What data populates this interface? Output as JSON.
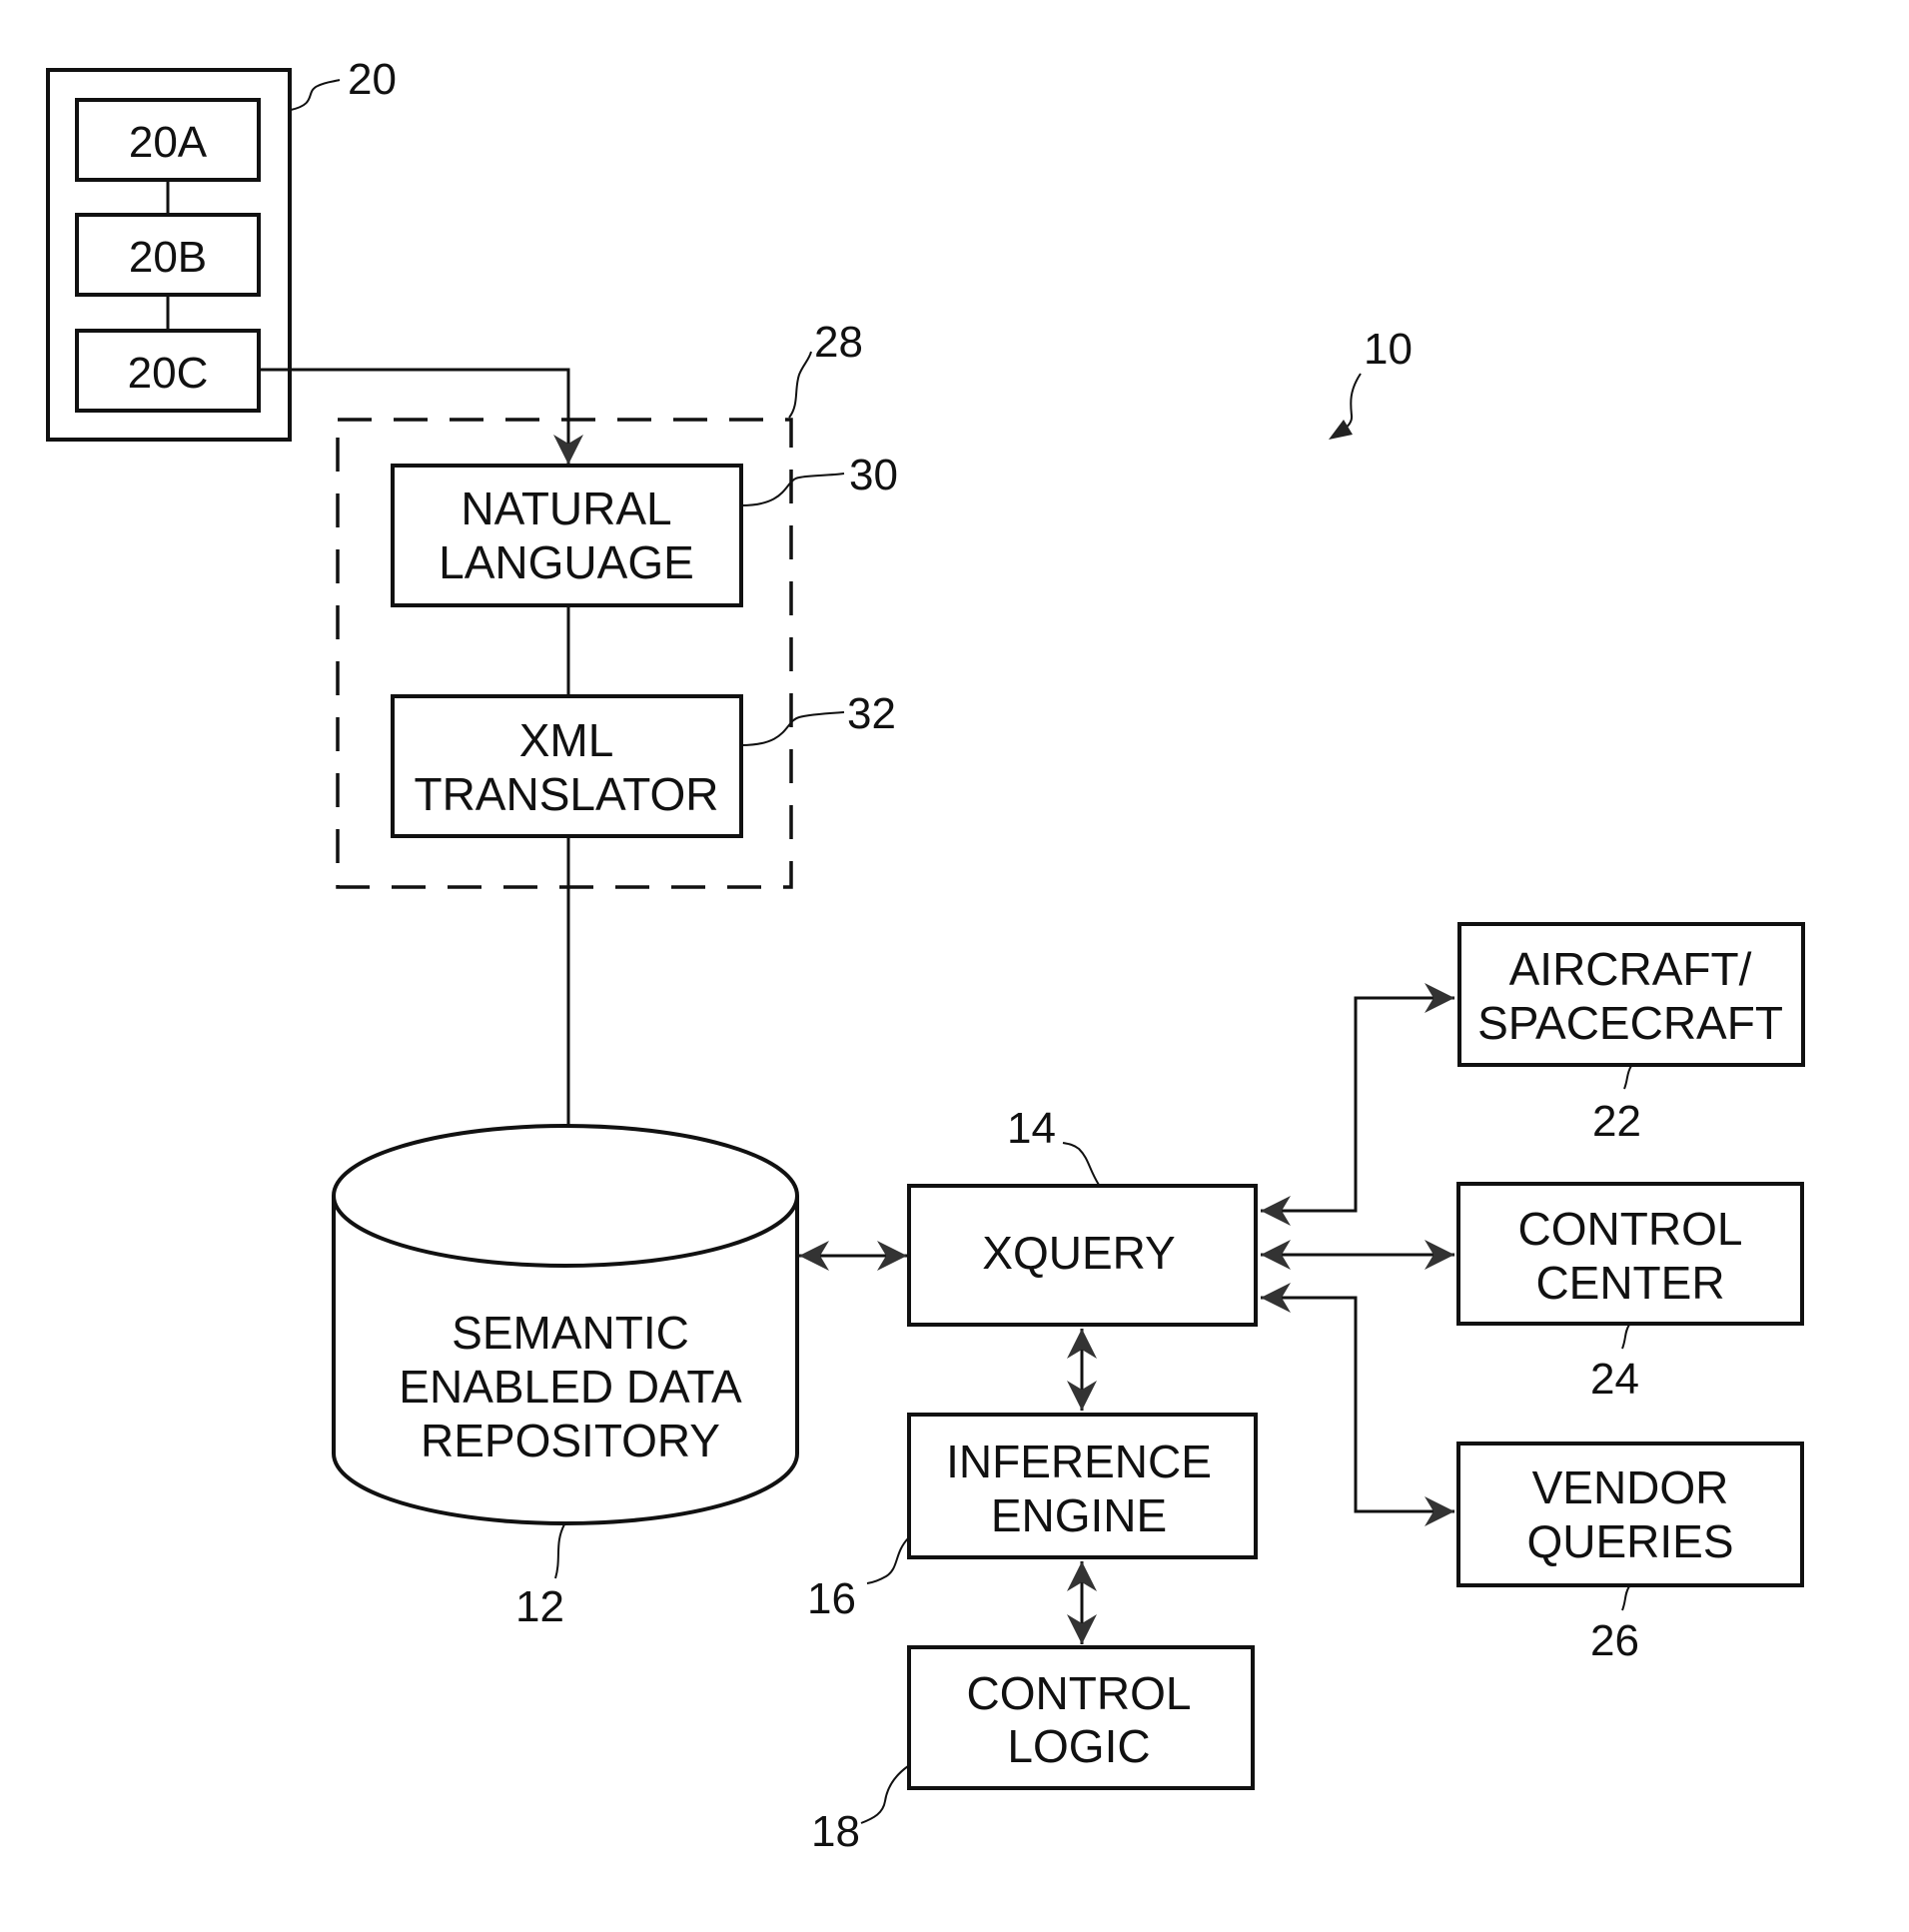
{
  "figure": {
    "system_ref": "10",
    "device": {
      "ref": "20",
      "components": [
        "20A",
        "20B",
        "20C"
      ]
    },
    "interface_group": {
      "ref": "28"
    },
    "natural_language": {
      "ref": "30",
      "lines": [
        "NATURAL",
        "LANGUAGE"
      ]
    },
    "xml_translator": {
      "ref": "32",
      "lines": [
        "XML",
        "TRANSLATOR"
      ]
    },
    "repository": {
      "ref": "12",
      "lines": [
        "SEMANTIC",
        "ENABLED DATA",
        "REPOSITORY"
      ]
    },
    "xquery": {
      "ref": "14",
      "lines": [
        "XQUERY"
      ]
    },
    "inference_engine": {
      "ref": "16",
      "lines": [
        "INFERENCE",
        "ENGINE"
      ]
    },
    "control_logic": {
      "ref": "18",
      "lines": [
        "CONTROL",
        "LOGIC"
      ]
    },
    "aircraft": {
      "ref": "22",
      "lines": [
        "AIRCRAFT/",
        "SPACECRAFT"
      ]
    },
    "control_center": {
      "ref": "24",
      "lines": [
        "CONTROL",
        "CENTER"
      ]
    },
    "vendor_queries": {
      "ref": "26",
      "lines": [
        "VENDOR",
        "QUERIES"
      ]
    }
  }
}
